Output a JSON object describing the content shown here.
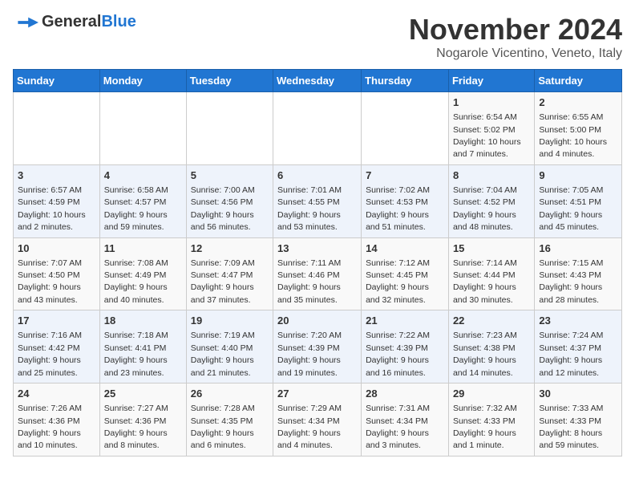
{
  "logo": {
    "general": "General",
    "blue": "Blue"
  },
  "title": "November 2024",
  "location": "Nogarole Vicentino, Veneto, Italy",
  "days_of_week": [
    "Sunday",
    "Monday",
    "Tuesday",
    "Wednesday",
    "Thursday",
    "Friday",
    "Saturday"
  ],
  "weeks": [
    [
      {
        "day": "",
        "info": ""
      },
      {
        "day": "",
        "info": ""
      },
      {
        "day": "",
        "info": ""
      },
      {
        "day": "",
        "info": ""
      },
      {
        "day": "",
        "info": ""
      },
      {
        "day": "1",
        "info": "Sunrise: 6:54 AM\nSunset: 5:02 PM\nDaylight: 10 hours and 7 minutes."
      },
      {
        "day": "2",
        "info": "Sunrise: 6:55 AM\nSunset: 5:00 PM\nDaylight: 10 hours and 4 minutes."
      }
    ],
    [
      {
        "day": "3",
        "info": "Sunrise: 6:57 AM\nSunset: 4:59 PM\nDaylight: 10 hours and 2 minutes."
      },
      {
        "day": "4",
        "info": "Sunrise: 6:58 AM\nSunset: 4:57 PM\nDaylight: 9 hours and 59 minutes."
      },
      {
        "day": "5",
        "info": "Sunrise: 7:00 AM\nSunset: 4:56 PM\nDaylight: 9 hours and 56 minutes."
      },
      {
        "day": "6",
        "info": "Sunrise: 7:01 AM\nSunset: 4:55 PM\nDaylight: 9 hours and 53 minutes."
      },
      {
        "day": "7",
        "info": "Sunrise: 7:02 AM\nSunset: 4:53 PM\nDaylight: 9 hours and 51 minutes."
      },
      {
        "day": "8",
        "info": "Sunrise: 7:04 AM\nSunset: 4:52 PM\nDaylight: 9 hours and 48 minutes."
      },
      {
        "day": "9",
        "info": "Sunrise: 7:05 AM\nSunset: 4:51 PM\nDaylight: 9 hours and 45 minutes."
      }
    ],
    [
      {
        "day": "10",
        "info": "Sunrise: 7:07 AM\nSunset: 4:50 PM\nDaylight: 9 hours and 43 minutes."
      },
      {
        "day": "11",
        "info": "Sunrise: 7:08 AM\nSunset: 4:49 PM\nDaylight: 9 hours and 40 minutes."
      },
      {
        "day": "12",
        "info": "Sunrise: 7:09 AM\nSunset: 4:47 PM\nDaylight: 9 hours and 37 minutes."
      },
      {
        "day": "13",
        "info": "Sunrise: 7:11 AM\nSunset: 4:46 PM\nDaylight: 9 hours and 35 minutes."
      },
      {
        "day": "14",
        "info": "Sunrise: 7:12 AM\nSunset: 4:45 PM\nDaylight: 9 hours and 32 minutes."
      },
      {
        "day": "15",
        "info": "Sunrise: 7:14 AM\nSunset: 4:44 PM\nDaylight: 9 hours and 30 minutes."
      },
      {
        "day": "16",
        "info": "Sunrise: 7:15 AM\nSunset: 4:43 PM\nDaylight: 9 hours and 28 minutes."
      }
    ],
    [
      {
        "day": "17",
        "info": "Sunrise: 7:16 AM\nSunset: 4:42 PM\nDaylight: 9 hours and 25 minutes."
      },
      {
        "day": "18",
        "info": "Sunrise: 7:18 AM\nSunset: 4:41 PM\nDaylight: 9 hours and 23 minutes."
      },
      {
        "day": "19",
        "info": "Sunrise: 7:19 AM\nSunset: 4:40 PM\nDaylight: 9 hours and 21 minutes."
      },
      {
        "day": "20",
        "info": "Sunrise: 7:20 AM\nSunset: 4:39 PM\nDaylight: 9 hours and 19 minutes."
      },
      {
        "day": "21",
        "info": "Sunrise: 7:22 AM\nSunset: 4:39 PM\nDaylight: 9 hours and 16 minutes."
      },
      {
        "day": "22",
        "info": "Sunrise: 7:23 AM\nSunset: 4:38 PM\nDaylight: 9 hours and 14 minutes."
      },
      {
        "day": "23",
        "info": "Sunrise: 7:24 AM\nSunset: 4:37 PM\nDaylight: 9 hours and 12 minutes."
      }
    ],
    [
      {
        "day": "24",
        "info": "Sunrise: 7:26 AM\nSunset: 4:36 PM\nDaylight: 9 hours and 10 minutes."
      },
      {
        "day": "25",
        "info": "Sunrise: 7:27 AM\nSunset: 4:36 PM\nDaylight: 9 hours and 8 minutes."
      },
      {
        "day": "26",
        "info": "Sunrise: 7:28 AM\nSunset: 4:35 PM\nDaylight: 9 hours and 6 minutes."
      },
      {
        "day": "27",
        "info": "Sunrise: 7:29 AM\nSunset: 4:34 PM\nDaylight: 9 hours and 4 minutes."
      },
      {
        "day": "28",
        "info": "Sunrise: 7:31 AM\nSunset: 4:34 PM\nDaylight: 9 hours and 3 minutes."
      },
      {
        "day": "29",
        "info": "Sunrise: 7:32 AM\nSunset: 4:33 PM\nDaylight: 9 hours and 1 minute."
      },
      {
        "day": "30",
        "info": "Sunrise: 7:33 AM\nSunset: 4:33 PM\nDaylight: 8 hours and 59 minutes."
      }
    ]
  ]
}
